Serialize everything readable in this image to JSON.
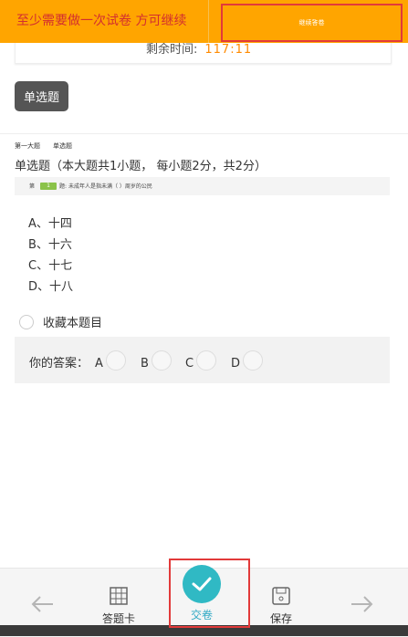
{
  "banner": {
    "notice": "至少需要做一次试卷 方可继续",
    "continue_label": "继续答卷"
  },
  "timer": {
    "label": "剩余时间:",
    "value": "117:11"
  },
  "question_type_button": "单选题",
  "section": {
    "part": "第一大题",
    "type": "单选题"
  },
  "question_heading": "单选题（本大题共1小题， 每小题2分，共2分）",
  "question": {
    "prefix": "第",
    "number": "1",
    "text": "题: 未成年人是指未满（ ）周岁的公民"
  },
  "options": [
    "A、十四",
    "B、十六",
    "C、十七",
    "D、十八"
  ],
  "favorite_label": "收藏本题目",
  "answer": {
    "label": "你的答案：",
    "choices": [
      "A",
      "B",
      "C",
      "D"
    ]
  },
  "bottom_nav": {
    "answer_card": "答题卡",
    "submit": "交卷",
    "save": "保存"
  },
  "colors": {
    "banner": "#ffa500",
    "notice_text": "#d32f2f",
    "timer_value": "#ff8a00",
    "submit": "#30b9c4",
    "highlight_border": "#e23a3a",
    "question_number_badge": "#8bc34a"
  }
}
